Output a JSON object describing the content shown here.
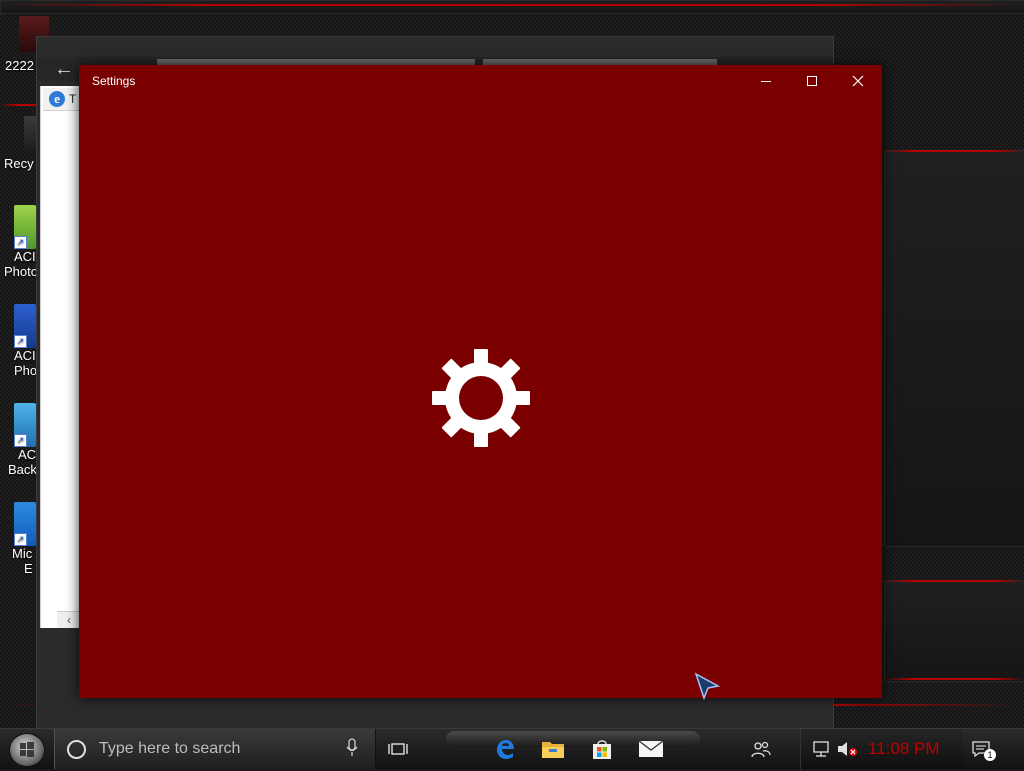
{
  "desktop": {
    "icons": [
      {
        "label_line1": "2222",
        "label_line2": ""
      },
      {
        "label_line1": "Recy",
        "label_line2": ""
      },
      {
        "label_line1": "ACI",
        "label_line2": "Photo"
      },
      {
        "label_line1": "ACI",
        "label_line2": "Pho"
      },
      {
        "label_line1": "AC",
        "label_line2": "Back"
      },
      {
        "label_line1": "Mic",
        "label_line2": "E"
      }
    ]
  },
  "browser_window": {
    "tab_text": "T"
  },
  "settings_window": {
    "title": "Settings",
    "loading_icon": "gear-icon"
  },
  "taskbar": {
    "search_placeholder": "Type here to search",
    "pinned": [
      "edge-icon",
      "file-explorer-icon",
      "store-icon",
      "mail-icon"
    ],
    "clock": "11:08 PM",
    "notification_count": "1"
  },
  "colors": {
    "settings_background": "#7a0000",
    "clock": "#c00000",
    "accent_lines": "#b40000"
  }
}
